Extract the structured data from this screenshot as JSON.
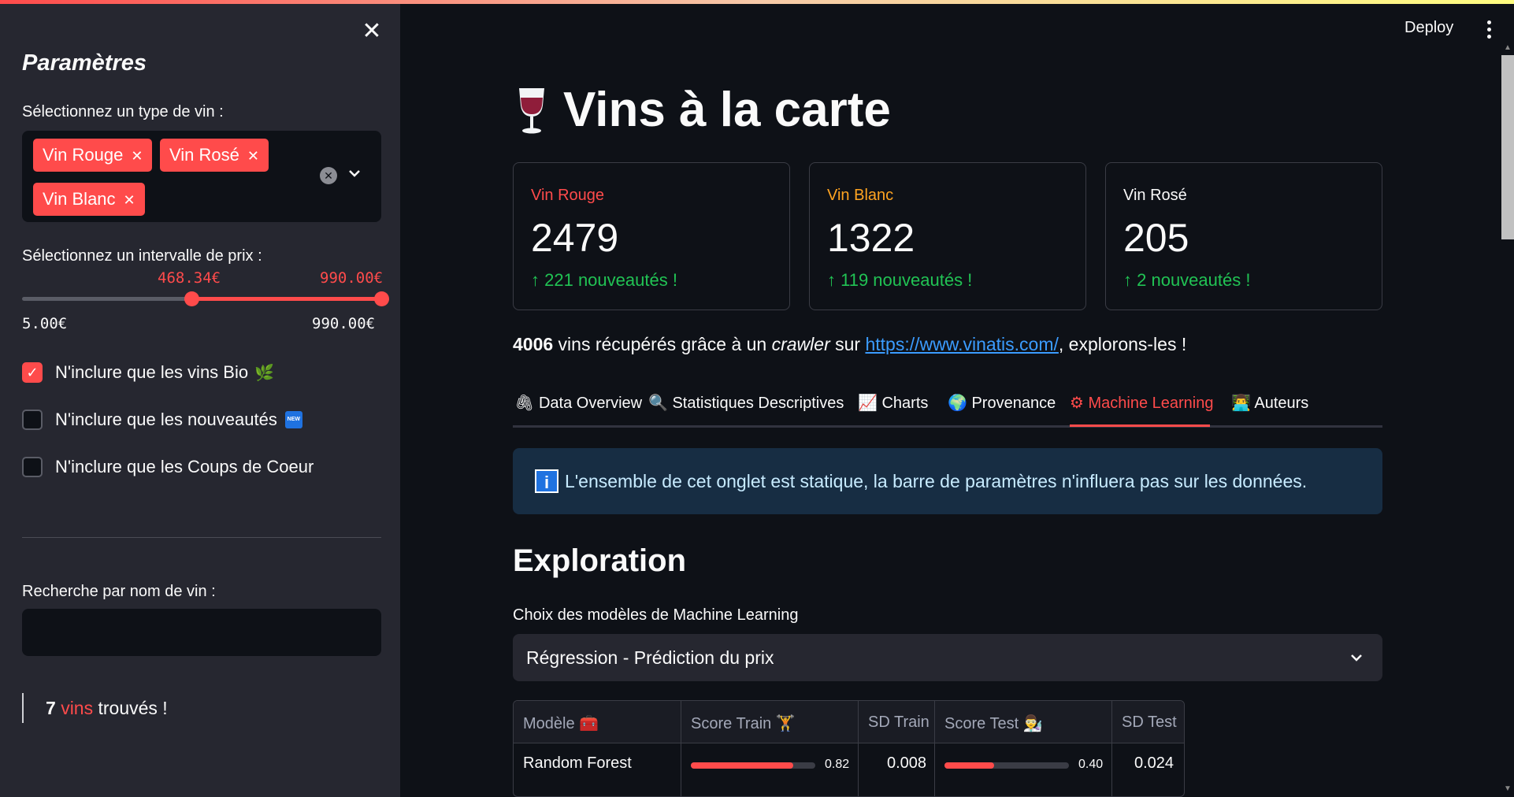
{
  "header": {
    "deploy_label": "Deploy"
  },
  "sidebar": {
    "title": "Paramètres",
    "wine_type_label": "Sélectionnez un type de vin :",
    "wine_types_selected": [
      "Vin Rouge",
      "Vin Rosé",
      "Vin Blanc"
    ],
    "price_label": "Sélectionnez un intervalle de prix :",
    "price": {
      "low_display": "468.34€",
      "high_display": "990.00€",
      "min_display": "5.00€",
      "max_display": "990.00€",
      "min": 5.0,
      "max": 990.0,
      "low": 468.34,
      "high": 990.0
    },
    "checkboxes": [
      {
        "label": "N'inclure que les vins Bio",
        "checked": true,
        "icon": "herb-icon",
        "emoji": "🌿"
      },
      {
        "label": "N'inclure que les nouveautés",
        "checked": false,
        "icon": "new-badge-icon",
        "badge": "NEW"
      },
      {
        "label": "N'inclure que les Coups de Coeur",
        "checked": false
      }
    ],
    "checkmark": "✓",
    "search_label": "Recherche par nom de vin :",
    "search_value": "",
    "found": {
      "count": "7",
      "word": "vins",
      "suffix": "trouvés !"
    }
  },
  "main": {
    "title": "Vins à la carte",
    "metrics": [
      {
        "label": "Vin Rouge",
        "value": "2479",
        "delta": "221 nouveautés !",
        "label_color": "#ff4b4b"
      },
      {
        "label": "Vin Blanc",
        "value": "1322",
        "delta": "119 nouveautés !",
        "label_color": "#ffa421"
      },
      {
        "label": "Vin Rosé",
        "value": "205",
        "delta": "2 nouveautés !",
        "label_color": "#fafafa"
      }
    ],
    "intro": {
      "count": "4006",
      "part1": " vins récupérés grâce à un ",
      "italic": "crawler",
      "part2": " sur ",
      "link": "https://www.vinatis.com/",
      "part3": ", explorons-les !"
    },
    "tabs": [
      {
        "icon": "🖇",
        "label": "Data Overview",
        "active": false
      },
      {
        "icon": "🔍",
        "label": "Statistiques Descriptives",
        "active": false
      },
      {
        "icon": "📈",
        "label": "Charts",
        "active": false
      },
      {
        "icon": "🌍",
        "label": "Provenance",
        "active": false
      },
      {
        "icon": "⚙",
        "label": "Machine Learning",
        "active": true
      },
      {
        "icon": "👨‍💻",
        "label": "Auteurs",
        "active": false
      }
    ],
    "info": {
      "icon_glyph": "i",
      "text": "L'ensemble de cet onglet est statique, la barre de paramètres n'influera pas sur les données."
    },
    "exploration_title": "Exploration",
    "model_select_label": "Choix des modèles de Machine Learning",
    "model_select_value": "Régression - Prédiction du prix",
    "table": {
      "headers": [
        "Modèle",
        "Score Train",
        "SD Train",
        "Score Test",
        "SD Test"
      ],
      "header_icons": [
        "🧰",
        "🏋",
        "",
        "👨‍🔬",
        ""
      ],
      "rows": [
        {
          "model": "Random Forest",
          "score_train": 0.82,
          "score_train_display": "0.82",
          "sd_train": "0.008",
          "score_test": 0.4,
          "score_test_display": "0.40",
          "sd_test": "0.024"
        }
      ]
    },
    "colors": {
      "accent": "#ff4b4b",
      "positive": "#21c354",
      "link": "#3b9cff",
      "info_bg": "#172d43"
    }
  }
}
